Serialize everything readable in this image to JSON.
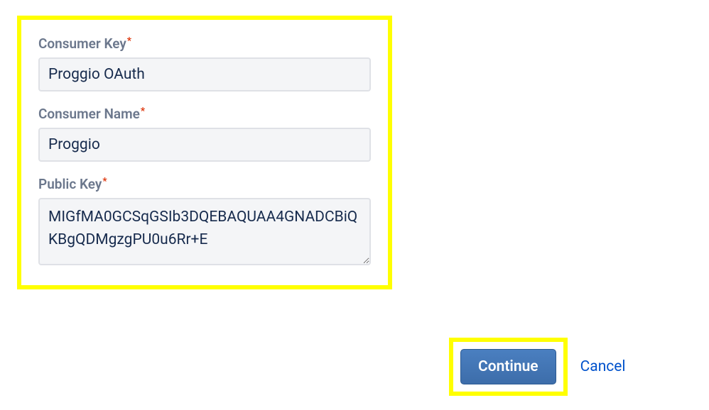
{
  "form": {
    "consumerKey": {
      "label": "Consumer Key",
      "value": "Proggio OAuth"
    },
    "consumerName": {
      "label": "Consumer Name",
      "value": "Proggio"
    },
    "publicKey": {
      "label": "Public Key",
      "value": "MIGfMA0GCSqGSIb3DQEBAQUAA4GNADCBiQKBgQDMgzgPU0u6Rr+E"
    }
  },
  "buttons": {
    "continue": "Continue",
    "cancel": "Cancel"
  }
}
